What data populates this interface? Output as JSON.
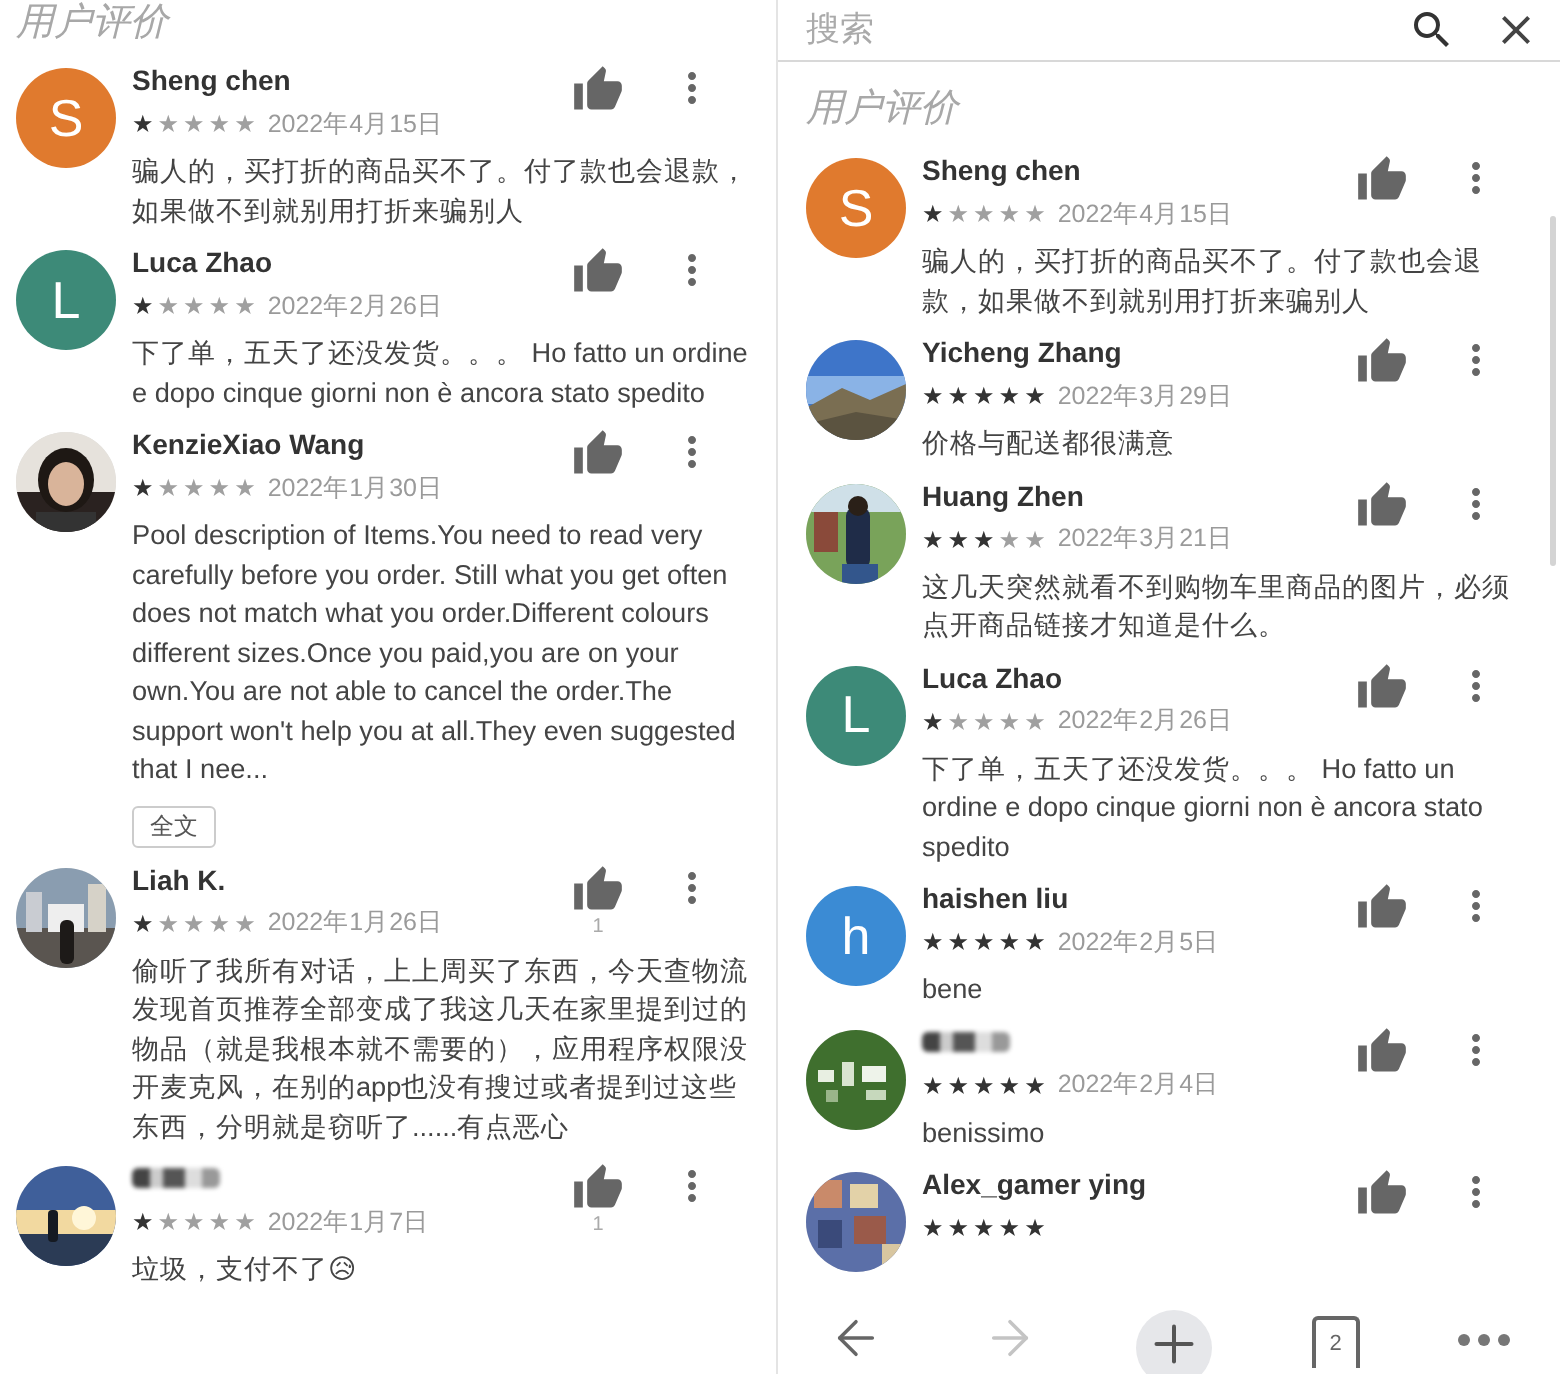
{
  "left_panel": {
    "title": "用户评价",
    "reviews": [
      {
        "author": "Sheng chen",
        "avatar": {
          "kind": "letter",
          "letter": "S",
          "color": "#e07a2e"
        },
        "stars": 1,
        "date": "2022年4月15日",
        "text": "骗人的，买打折的商品买不了。付了款也会退款，如果做不到就别用打折来骗别人"
      },
      {
        "author": "Luca Zhao",
        "avatar": {
          "kind": "letter",
          "letter": "L",
          "color": "#3d8a78"
        },
        "stars": 1,
        "date": "2022年2月26日",
        "text": "下了单，五天了还没发货。。。 Ho fatto un ordine e dopo cinque giorni non è ancora stato spedito"
      },
      {
        "author": "KenzieXiao Wang",
        "stars": 1,
        "date": "2022年1月30日",
        "text": "Pool description of Items.You need to read very carefully before you order. Still what you get often does not match what you order.Different colours different sizes.Once you paid,you are on your own.You are not able to cancel the order.The support won't help you at all.They even suggested that I nee...",
        "more_button": "全文"
      },
      {
        "author": "Liah K.",
        "stars": 1,
        "date": "2022年1月26日",
        "likes": "1",
        "text": "偷听了我所有对话，上上周买了东西，今天查物流发现首页推荐全部变成了我这几天在家里提到过的物品（就是我根本就不需要的），应用程序权限没开麦克风，在别的app也没有搜过或者提到过这些东西，分明就是窃听了......有点恶心"
      },
      {
        "author_blurred": true,
        "stars": 1,
        "date": "2022年1月7日",
        "likes": "1",
        "text": "垃圾，支付不了😥"
      }
    ]
  },
  "right_panel": {
    "search": {
      "placeholder": "搜索"
    },
    "title": "用户评价",
    "reviews": [
      {
        "author": "Sheng chen",
        "avatar": {
          "kind": "letter",
          "letter": "S",
          "color": "#e07a2e"
        },
        "stars": 1,
        "date": "2022年4月15日",
        "text": "骗人的，买打折的商品买不了。付了款也会退款，如果做不到就别用打折来骗别人"
      },
      {
        "author": "Yicheng Zhang",
        "stars": 5,
        "date": "2022年3月29日",
        "text": "价格与配送都很满意"
      },
      {
        "author": "Huang Zhen",
        "stars": 3,
        "date": "2022年3月21日",
        "text": "这几天突然就看不到购物车里商品的图片，必须点开商品链接才知道是什么。"
      },
      {
        "author": "Luca Zhao",
        "avatar": {
          "kind": "letter",
          "letter": "L",
          "color": "#3d8a78"
        },
        "stars": 1,
        "date": "2022年2月26日",
        "text": "下了单，五天了还没发货。。。 Ho fatto un ordine e dopo cinque giorni non è ancora stato spedito"
      },
      {
        "author": "haishen liu",
        "avatar": {
          "kind": "letter",
          "letter": "h",
          "color": "#3b8bd4"
        },
        "stars": 5,
        "date": "2022年2月5日",
        "text": "bene"
      },
      {
        "author_blurred": true,
        "stars": 5,
        "date": "2022年2月4日",
        "text": "benissimo"
      },
      {
        "author": "Alex_gamer ying",
        "stars": 5
      }
    ],
    "bottom_bar": {
      "tab_count": "2",
      "forward_disabled": true
    }
  }
}
